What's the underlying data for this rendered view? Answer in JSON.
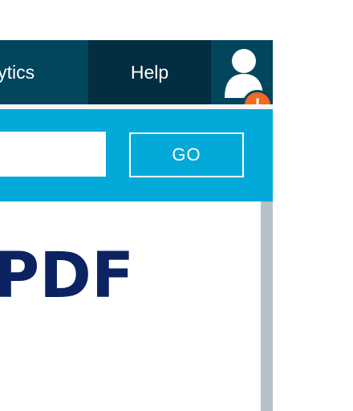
{
  "nav": {
    "items": [
      {
        "label": "lytics"
      },
      {
        "label": "Help"
      }
    ],
    "account_icon": "user-icon",
    "alert_badge": "!"
  },
  "search": {
    "value": "",
    "placeholder": "",
    "go_label": "GO"
  },
  "content": {
    "heading": "PDF"
  },
  "colors": {
    "nav_bg": "#02465e",
    "nav_active_bg": "#032d40",
    "search_bar_bg": "#03a9d9",
    "alert_badge": "#f06a23",
    "heading_text": "#0b2360",
    "scrollbar": "#b6c2c9"
  }
}
